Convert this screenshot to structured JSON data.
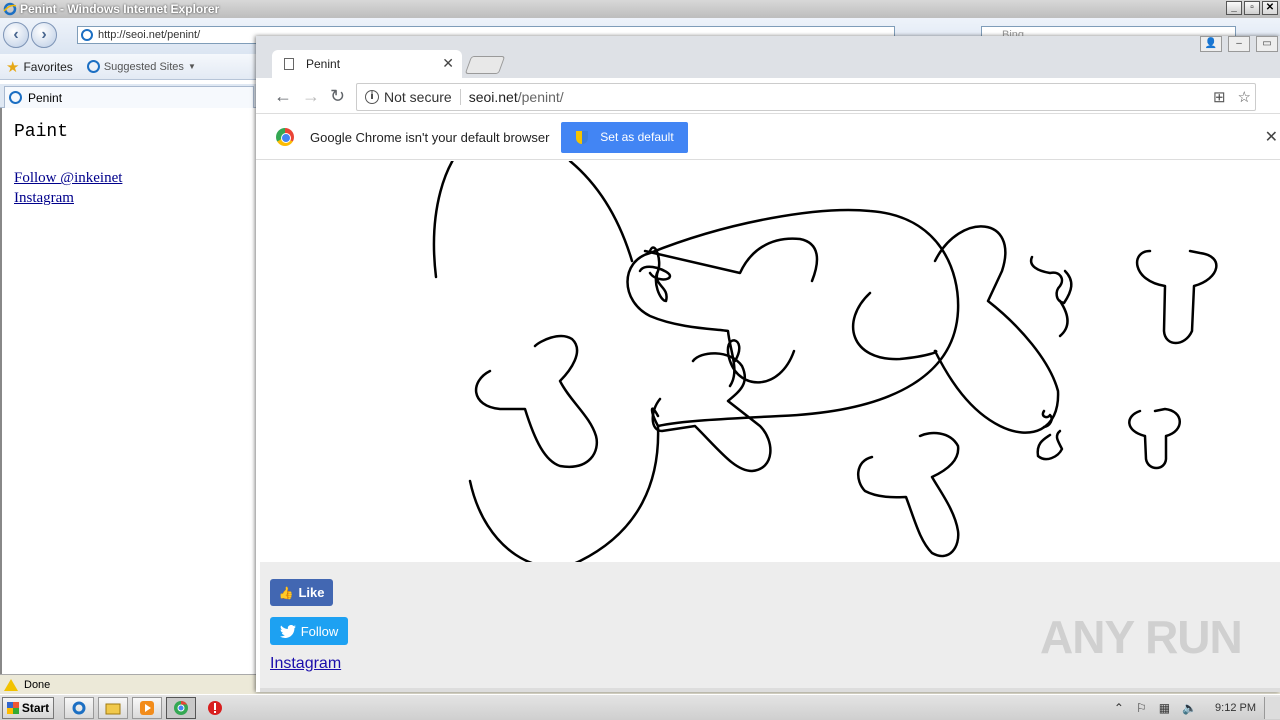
{
  "ie": {
    "title": "Penint - Windows Internet Explorer",
    "address": "http://seoi.net/penint/",
    "search_placeholder": "Bing",
    "favorites_label": "Favorites",
    "suggested_sites_label": "Suggested Sites",
    "tab_title": "Penint",
    "page": {
      "heading": "Paint",
      "follow_link": "Follow @inkeinet",
      "instagram_link": "Instagram"
    },
    "status_text": "Done"
  },
  "chrome": {
    "tab_title": "Penint",
    "not_secure_label": "Not secure",
    "url_host": "seoi.net",
    "url_path": "/penint/",
    "infobar_message": "Google Chrome isn't your default browser",
    "set_default_label": "Set as default",
    "page": {
      "like_label": "Like",
      "follow_label": "Follow",
      "instagram_label": "Instagram",
      "watermark": "ANY RUN"
    }
  },
  "taskbar": {
    "start_label": "Start",
    "clock": "9:12 PM"
  },
  "colors": {
    "facebook": "#4267b2",
    "twitter": "#1da1f2",
    "chrome_button": "#4285f4",
    "ink": "#000000"
  }
}
